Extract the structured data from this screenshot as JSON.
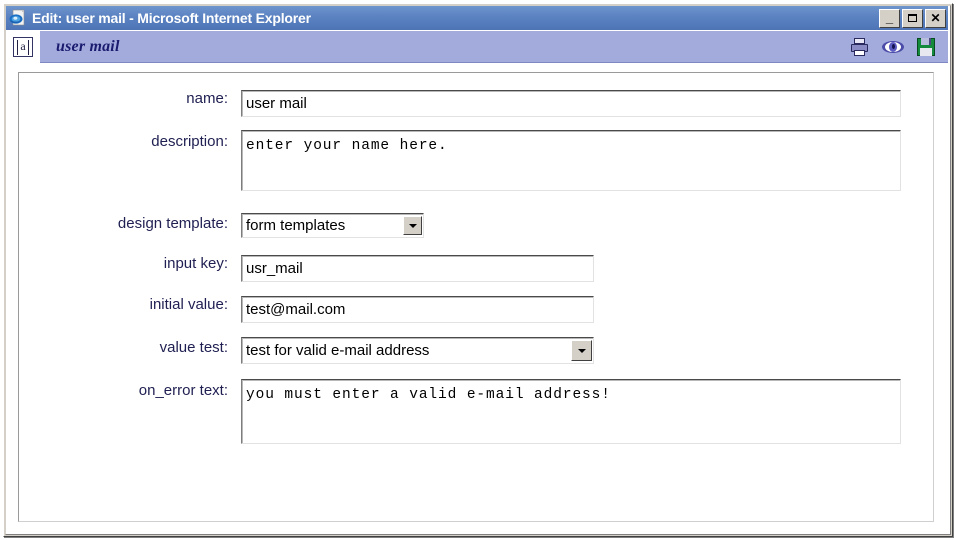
{
  "window": {
    "title": "Edit: user mail - Microsoft Internet Explorer",
    "app_icon": "internet-explorer-icon",
    "buttons": {
      "minimize": "_",
      "maximize": "□",
      "close": "✕"
    }
  },
  "appheader": {
    "icon": "text-field-icon",
    "icon_glyph": "a",
    "title": "user mail",
    "tools": [
      {
        "name": "print-icon",
        "label": "print"
      },
      {
        "name": "preview-eye-icon",
        "label": "preview"
      },
      {
        "name": "save-disk-icon",
        "label": "save"
      }
    ]
  },
  "form": {
    "fields": [
      {
        "label": "name:",
        "type": "text",
        "value": "user mail"
      },
      {
        "label": "description:",
        "type": "textarea",
        "value": "enter your name here."
      },
      {
        "label": "design template:",
        "type": "select",
        "value": "form templates"
      },
      {
        "label": "input key:",
        "type": "text",
        "value": "usr_mail"
      },
      {
        "label": "initial value:",
        "type": "text",
        "value": "test@mail.com"
      },
      {
        "label": "value test:",
        "type": "select",
        "value": "test for valid e-mail address"
      },
      {
        "label": "on_error text:",
        "type": "textarea",
        "value": "you must enter a valid e-mail address!"
      }
    ]
  },
  "colors": {
    "titlebar": "#5b82c1",
    "appheader": "#a3abdd",
    "label_text": "#1f1f52",
    "app_title_text": "#1a1a6e"
  }
}
